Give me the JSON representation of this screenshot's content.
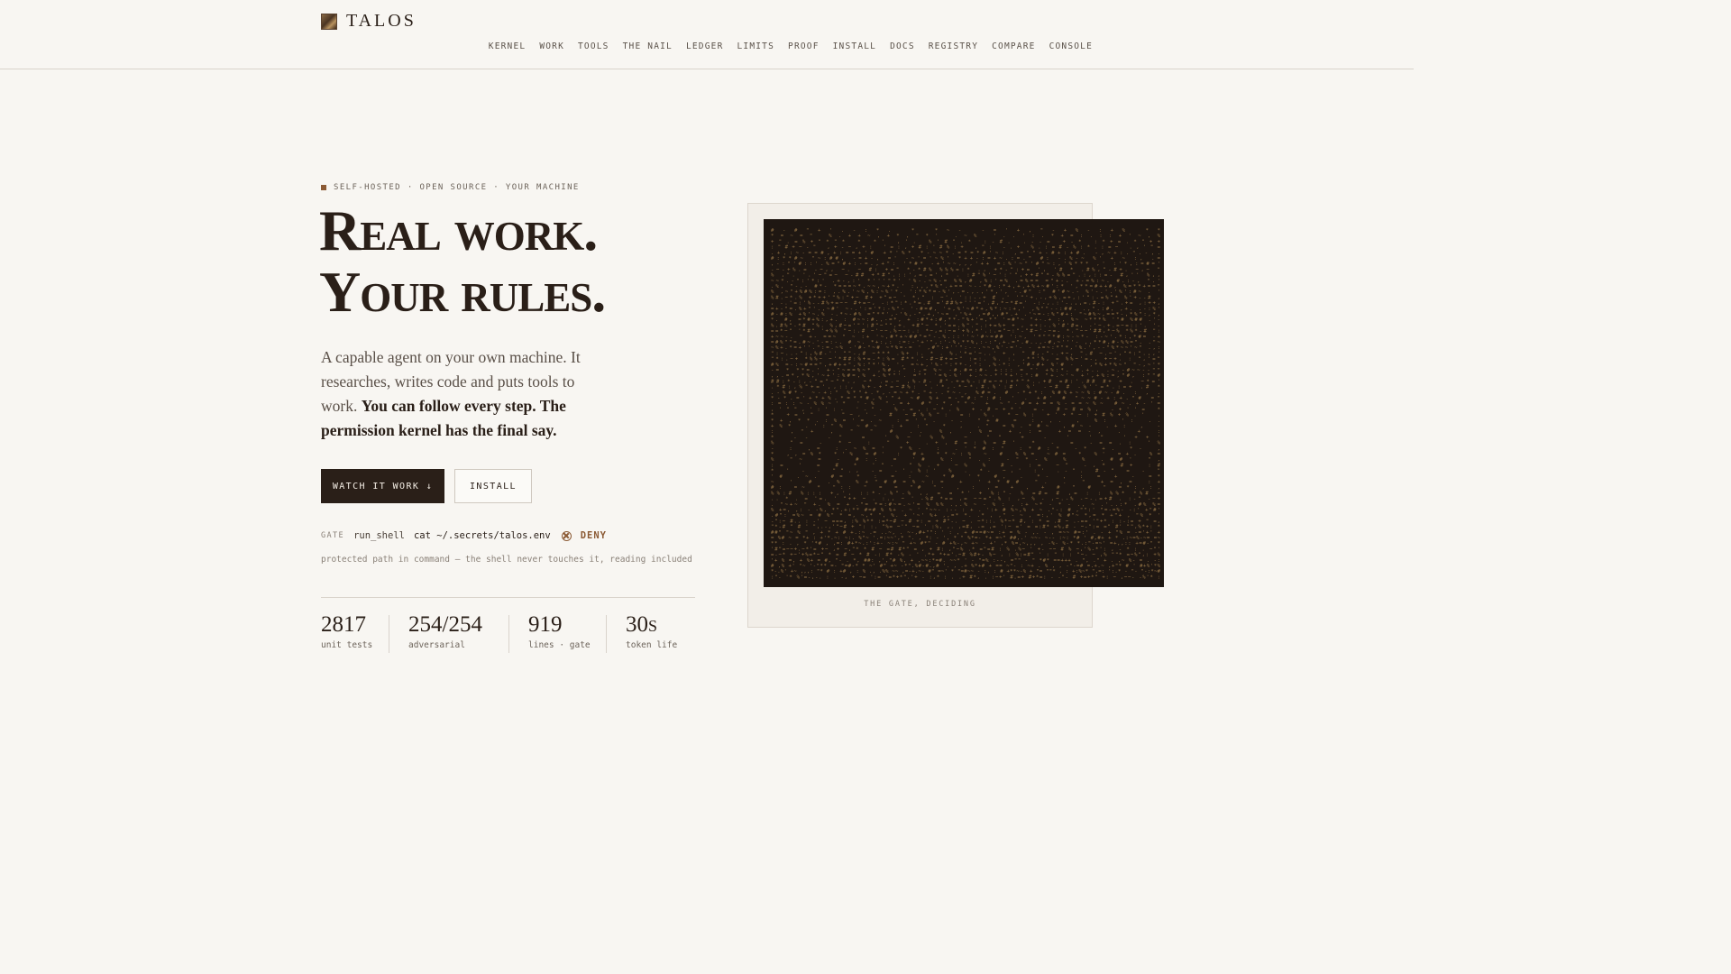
{
  "brand": {
    "name": "TALOS",
    "icon": "talos-bust-icon"
  },
  "nav": {
    "items": [
      "KERNEL",
      "WORK",
      "TOOLS",
      "THE NAIL",
      "LEDGER",
      "LIMITS",
      "PROOF",
      "INSTALL",
      "DOCS",
      "REGISTRY",
      "COMPARE",
      "CONSOLE"
    ]
  },
  "hero": {
    "eyebrow": "SELF-HOSTED · OPEN SOURCE · YOUR MACHINE",
    "headline_line1": "Real work.",
    "headline_line2": "Your rules.",
    "lede_plain": "A capable agent on your own machine. It researches, writes code and puts tools to work.",
    "lede_bold": "You can follow every step. The permission kernel has the final say.",
    "primary_button": "WATCH IT WORK ↓",
    "secondary_button": "INSTALL"
  },
  "gate": {
    "label": "GATE",
    "tool": "run_shell",
    "command": "cat ~/.secrets/talos.env",
    "verdict": "DENY",
    "verdict_icon": "deny-icon",
    "note": "protected path in command — the shell never touches it, reading included"
  },
  "stats": [
    {
      "value": "2817",
      "label": "unit tests"
    },
    {
      "value": "254/254",
      "label": "adversarial"
    },
    {
      "value": "919",
      "label": "lines · gate"
    },
    {
      "value": "30s",
      "label": "token life"
    }
  ],
  "figure": {
    "caption": "THE GATE, DECIDING",
    "art": "ascii-portrait-bust"
  },
  "colors": {
    "background": "#f8f6f2",
    "ink": "#2a1f18",
    "accent": "#8b5a34",
    "art_background": "#1f1712",
    "art_glyph": "#a8844f"
  }
}
